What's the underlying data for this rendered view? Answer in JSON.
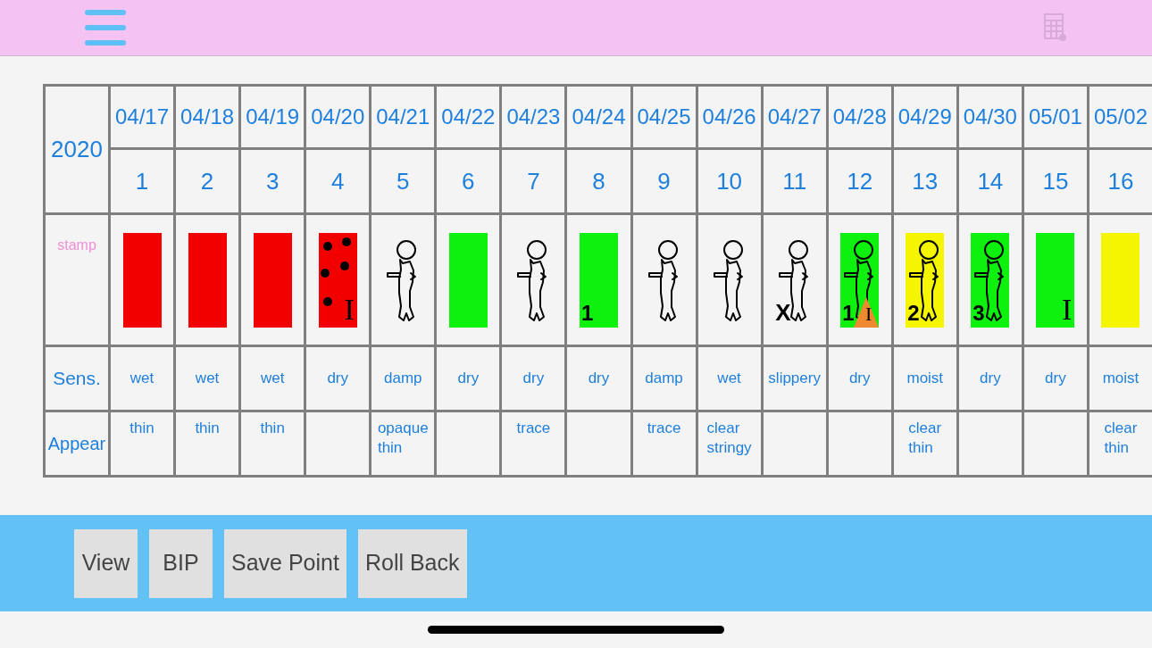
{
  "calendar": {
    "year": "2020",
    "stamp_label": "stamp",
    "sensation_label": "Sens.",
    "appearance_label": "Appear",
    "days": [
      {
        "date": "04/17",
        "day": "1",
        "stamp": {
          "color": "#f20000",
          "baby": false,
          "dots": false,
          "triangle": false
        },
        "sensation": "wet",
        "appearance": "thin"
      },
      {
        "date": "04/18",
        "day": "2",
        "stamp": {
          "color": "#f20000",
          "baby": false,
          "dots": false,
          "triangle": false
        },
        "sensation": "wet",
        "appearance": "thin"
      },
      {
        "date": "04/19",
        "day": "3",
        "stamp": {
          "color": "#f20000",
          "baby": false,
          "dots": false,
          "triangle": false
        },
        "sensation": "wet",
        "appearance": "thin"
      },
      {
        "date": "04/20",
        "day": "4",
        "stamp": {
          "color": "#f20000",
          "baby": false,
          "dots": true,
          "triangle": false,
          "letter": "I"
        },
        "sensation": "dry"
      },
      {
        "date": "04/21",
        "day": "5",
        "stamp": {
          "baby": true,
          "dots": false,
          "triangle": false
        },
        "sensation": "damp",
        "appearance": "opaque\nthin"
      },
      {
        "date": "04/22",
        "day": "6",
        "stamp": {
          "color": "#0ef00e",
          "baby": false,
          "dots": false,
          "triangle": false
        },
        "sensation": "dry"
      },
      {
        "date": "04/23",
        "day": "7",
        "stamp": {
          "baby": true,
          "dots": false,
          "triangle": false
        },
        "sensation": "dry",
        "appearance": "trace"
      },
      {
        "date": "04/24",
        "day": "8",
        "stamp": {
          "color": "#0ef00e",
          "baby": false,
          "dots": false,
          "triangle": false,
          "number": "1"
        },
        "sensation": "dry"
      },
      {
        "date": "04/25",
        "day": "9",
        "stamp": {
          "baby": true,
          "dots": false,
          "triangle": false
        },
        "sensation": "damp",
        "appearance": "trace"
      },
      {
        "date": "04/26",
        "day": "10",
        "stamp": {
          "baby": true,
          "dots": false,
          "triangle": false
        },
        "sensation": "wet",
        "appearance": "clear\nstringy"
      },
      {
        "date": "04/27",
        "day": "11",
        "stamp": {
          "baby": true,
          "dots": false,
          "triangle": false,
          "cross": "X"
        },
        "sensation": "slippery"
      },
      {
        "date": "04/28",
        "day": "12",
        "stamp": {
          "color": "#0ef00e",
          "baby": true,
          "dots": false,
          "triangle": true,
          "number": "1",
          "letter": "I"
        },
        "sensation": "dry"
      },
      {
        "date": "04/29",
        "day": "13",
        "stamp": {
          "color": "#f5f500",
          "baby": true,
          "dots": false,
          "triangle": false,
          "number": "2"
        },
        "sensation": "moist",
        "appearance": "clear\nthin"
      },
      {
        "date": "04/30",
        "day": "14",
        "stamp": {
          "color": "#0ef00e",
          "baby": true,
          "dots": false,
          "triangle": false,
          "number": "3"
        },
        "sensation": "dry"
      },
      {
        "date": "05/01",
        "day": "15",
        "stamp": {
          "color": "#0ef00e",
          "baby": false,
          "dots": false,
          "triangle": false,
          "letter": "I"
        },
        "sensation": "dry"
      },
      {
        "date": "05/02",
        "day": "16",
        "stamp": {
          "color": "#f5f500",
          "baby": false,
          "dots": false,
          "triangle": false
        },
        "sensation": "moist",
        "appearance": "clear\nthin"
      }
    ]
  },
  "toolbar": {
    "buttons": [
      "View",
      "BIP",
      "Save Point",
      "Roll Back"
    ]
  }
}
